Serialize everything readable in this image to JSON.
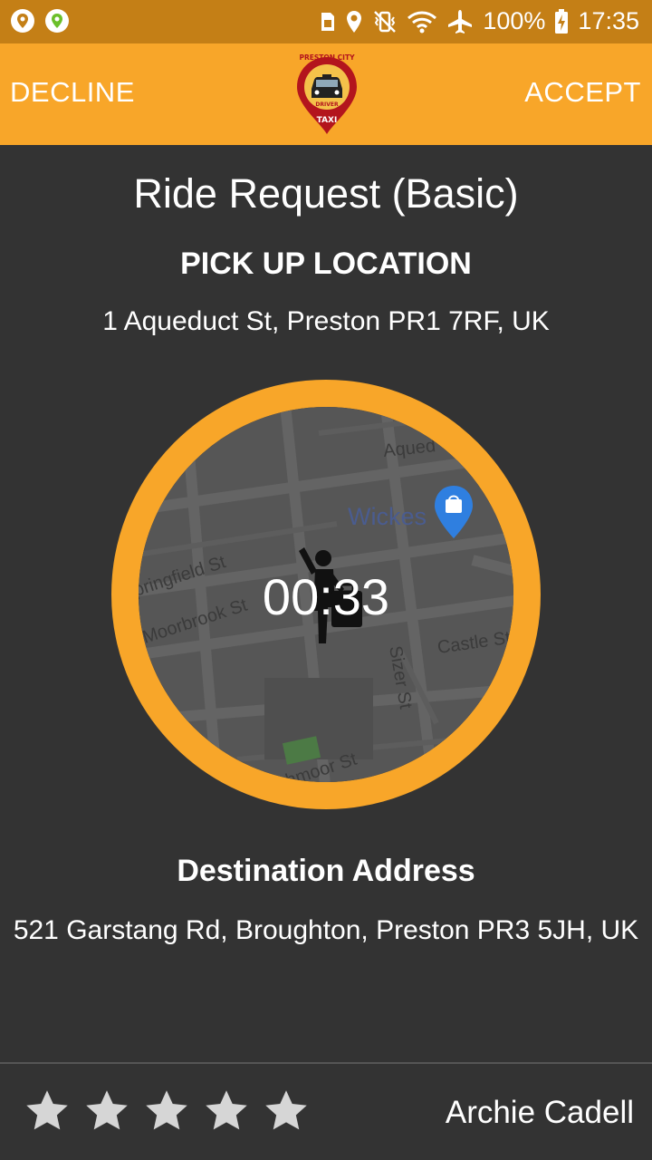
{
  "status_bar": {
    "battery": "100%",
    "time": "17:35",
    "left_icons": [
      "location-pin-icon",
      "map-pin-icon"
    ],
    "right_icons": [
      "sim-icon",
      "location-icon",
      "vibrate-icon",
      "wifi-icon",
      "airplane-icon",
      "battery-charging-icon"
    ]
  },
  "app_bar": {
    "decline_label": "DECLINE",
    "accept_label": "ACCEPT",
    "logo": {
      "top_text": "PRESTON CITY",
      "middle_text": "DRIVER",
      "bottom_text": "TAXI"
    }
  },
  "request": {
    "title": "Ride Request (Basic)",
    "pickup_heading": "PICK UP LOCATION",
    "pickup_address": "1 Aqueduct St, Preston PR1 7RF, UK"
  },
  "map": {
    "labels": [
      "Aqued",
      "Wickes",
      "pringfield St",
      "Moorbrook St",
      "Sizer St",
      "Castle St",
      "hmoor St"
    ],
    "icons": [
      "shopping-bag-marker-icon",
      "hailing-passenger-icon"
    ]
  },
  "timer": {
    "text": "00:33",
    "elapsed_fraction": 0.15
  },
  "destination": {
    "heading": "Destination Address",
    "address": "521 Garstang Rd, Broughton, Preston PR3 5JH, UK"
  },
  "rider": {
    "name": "Archie Cadell",
    "rating": 5,
    "max_rating": 5
  },
  "colors": {
    "accent": "#f8a629",
    "status_bar": "#c47f16",
    "background": "#333333",
    "ring_remaining": "#ffffff",
    "logo_red": "#b3151d"
  }
}
